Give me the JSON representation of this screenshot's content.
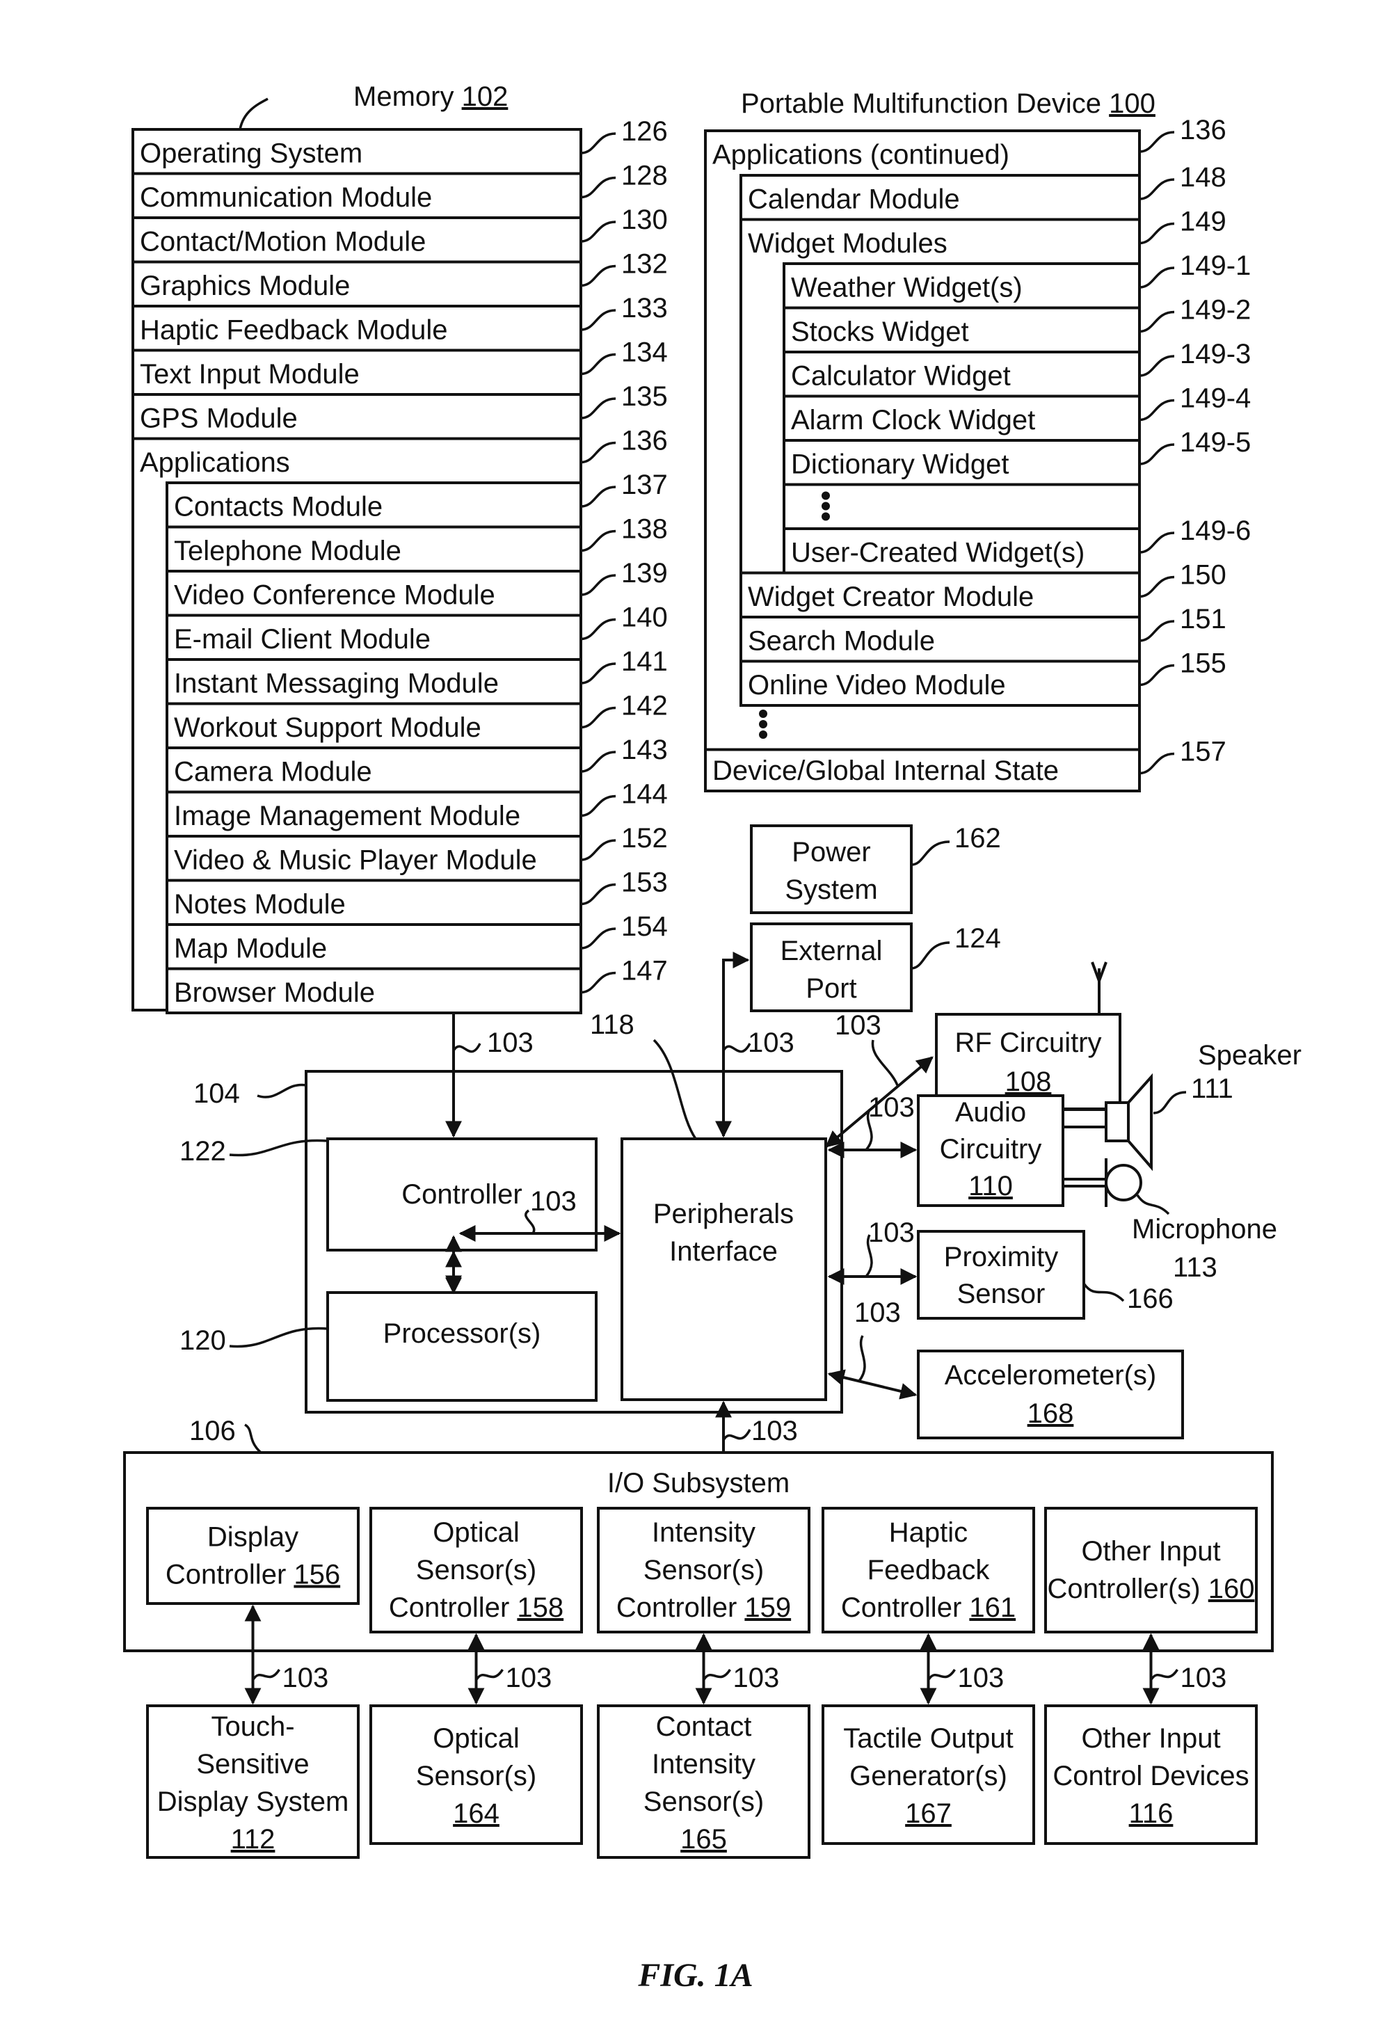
{
  "figure": {
    "caption": "FIG. 1A",
    "memory": {
      "title": "Memory",
      "ref": "102",
      "items": [
        {
          "label": "Operating System",
          "ref": "126"
        },
        {
          "label": "Communication Module",
          "ref": "128"
        },
        {
          "label": "Contact/Motion Module",
          "ref": "130"
        },
        {
          "label": "Graphics Module",
          "ref": "132"
        },
        {
          "label": "Haptic Feedback Module",
          "ref": "133"
        },
        {
          "label": "Text Input Module",
          "ref": "134"
        },
        {
          "label": "GPS Module",
          "ref": "135"
        }
      ],
      "applications": {
        "label": "Applications",
        "ref": "136",
        "items": [
          {
            "label": "Contacts Module",
            "ref": "137"
          },
          {
            "label": "Telephone Module",
            "ref": "138"
          },
          {
            "label": "Video Conference Module",
            "ref": "139"
          },
          {
            "label": "E-mail Client Module",
            "ref": "140"
          },
          {
            "label": "Instant Messaging Module",
            "ref": "141"
          },
          {
            "label": "Workout Support Module",
            "ref": "142"
          },
          {
            "label": "Camera Module",
            "ref": "143"
          },
          {
            "label": "Image Management Module",
            "ref": "144"
          },
          {
            "label": "Video & Music Player Module",
            "ref": "152"
          },
          {
            "label": "Notes Module",
            "ref": "153"
          },
          {
            "label": "Map Module",
            "ref": "154"
          },
          {
            "label": "Browser Module",
            "ref": "147"
          }
        ]
      }
    },
    "device": {
      "title": "Portable Multifunction Device",
      "ref": "100",
      "applications_continued": {
        "label": "Applications (continued)",
        "ref": "136"
      },
      "calendar": {
        "label": "Calendar Module",
        "ref": "148"
      },
      "widget_modules": {
        "label": "Widget Modules",
        "ref": "149",
        "items": [
          {
            "label": "Weather Widget(s)",
            "ref": "149-1"
          },
          {
            "label": "Stocks Widget",
            "ref": "149-2"
          },
          {
            "label": "Calculator Widget",
            "ref": "149-3"
          },
          {
            "label": "Alarm Clock Widget",
            "ref": "149-4"
          },
          {
            "label": "Dictionary Widget",
            "ref": "149-5"
          }
        ],
        "user_created": {
          "label": "User-Created Widget(s)",
          "ref": "149-6"
        }
      },
      "more_apps": [
        {
          "label": "Widget Creator Module",
          "ref": "150"
        },
        {
          "label": "Search Module",
          "ref": "151"
        },
        {
          "label": "Online Video Module",
          "ref": "155"
        }
      ],
      "state": {
        "label": "Device/Global Internal State",
        "ref": "157"
      }
    },
    "power_system": {
      "lines": [
        "Power",
        "System"
      ],
      "ref": "162"
    },
    "external_port": {
      "lines": [
        "External",
        "Port"
      ],
      "ref": "124"
    },
    "rf_circuitry": {
      "label": "RF Circuitry",
      "ref": "108"
    },
    "audio_circuitry": {
      "lines": [
        "Audio",
        "Circuitry"
      ],
      "ref": "110"
    },
    "speaker": {
      "label": "Speaker",
      "ref": "111"
    },
    "microphone": {
      "label": "Microphone",
      "ref": "113"
    },
    "proximity_sensor": {
      "lines": [
        "Proximity",
        "Sensor"
      ],
      "ref": "166"
    },
    "accelerometer": {
      "label": "Accelerometer(s)",
      "ref": "168"
    },
    "chip": {
      "ref": "104"
    },
    "controller": {
      "label": "Controller",
      "ref": "122"
    },
    "processor": {
      "label": "Processor(s)",
      "ref": "120"
    },
    "peripherals_interface": {
      "lines": [
        "Peripherals",
        "Interface"
      ],
      "ref": "118"
    },
    "bus_ref": "103",
    "io_subsystem": {
      "label": "I/O Subsystem",
      "ref": "106",
      "controllers": [
        {
          "lines": [
            "Display",
            "Controller"
          ],
          "ref": "156"
        },
        {
          "lines": [
            "Optical",
            "Sensor(s)",
            "Controller"
          ],
          "ref": "158"
        },
        {
          "lines": [
            "Intensity",
            "Sensor(s)",
            "Controller"
          ],
          "ref": "159"
        },
        {
          "lines": [
            "Haptic",
            "Feedback",
            "Controller"
          ],
          "ref": "161"
        },
        {
          "lines": [
            "Other Input",
            "Controller(s)"
          ],
          "ref": "160"
        }
      ]
    },
    "devices": [
      {
        "lines": [
          "Touch-",
          "Sensitive",
          "Display System"
        ],
        "ref": "112"
      },
      {
        "lines": [
          "Optical",
          "Sensor(s)"
        ],
        "ref": "164"
      },
      {
        "lines": [
          "Contact",
          "Intensity",
          "Sensor(s)"
        ],
        "ref": "165"
      },
      {
        "lines": [
          "Tactile Output",
          "Generator(s)"
        ],
        "ref": "167"
      },
      {
        "lines": [
          "Other Input",
          "Control Devices"
        ],
        "ref": "116"
      }
    ]
  }
}
